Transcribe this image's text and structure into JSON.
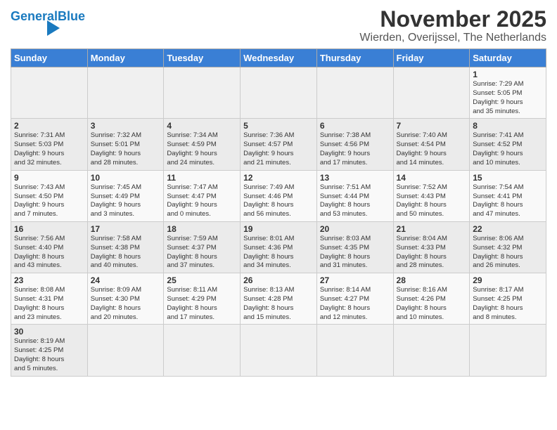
{
  "header": {
    "logo_general": "General",
    "logo_blue": "Blue",
    "title": "November 2025",
    "subtitle": "Wierden, Overijssel, The Netherlands"
  },
  "columns": [
    "Sunday",
    "Monday",
    "Tuesday",
    "Wednesday",
    "Thursday",
    "Friday",
    "Saturday"
  ],
  "weeks": [
    [
      {
        "day": "",
        "info": ""
      },
      {
        "day": "",
        "info": ""
      },
      {
        "day": "",
        "info": ""
      },
      {
        "day": "",
        "info": ""
      },
      {
        "day": "",
        "info": ""
      },
      {
        "day": "",
        "info": ""
      },
      {
        "day": "1",
        "info": "Sunrise: 7:29 AM\nSunset: 5:05 PM\nDaylight: 9 hours\nand 35 minutes."
      }
    ],
    [
      {
        "day": "2",
        "info": "Sunrise: 7:31 AM\nSunset: 5:03 PM\nDaylight: 9 hours\nand 32 minutes."
      },
      {
        "day": "3",
        "info": "Sunrise: 7:32 AM\nSunset: 5:01 PM\nDaylight: 9 hours\nand 28 minutes."
      },
      {
        "day": "4",
        "info": "Sunrise: 7:34 AM\nSunset: 4:59 PM\nDaylight: 9 hours\nand 24 minutes."
      },
      {
        "day": "5",
        "info": "Sunrise: 7:36 AM\nSunset: 4:57 PM\nDaylight: 9 hours\nand 21 minutes."
      },
      {
        "day": "6",
        "info": "Sunrise: 7:38 AM\nSunset: 4:56 PM\nDaylight: 9 hours\nand 17 minutes."
      },
      {
        "day": "7",
        "info": "Sunrise: 7:40 AM\nSunset: 4:54 PM\nDaylight: 9 hours\nand 14 minutes."
      },
      {
        "day": "8",
        "info": "Sunrise: 7:41 AM\nSunset: 4:52 PM\nDaylight: 9 hours\nand 10 minutes."
      }
    ],
    [
      {
        "day": "9",
        "info": "Sunrise: 7:43 AM\nSunset: 4:50 PM\nDaylight: 9 hours\nand 7 minutes."
      },
      {
        "day": "10",
        "info": "Sunrise: 7:45 AM\nSunset: 4:49 PM\nDaylight: 9 hours\nand 3 minutes."
      },
      {
        "day": "11",
        "info": "Sunrise: 7:47 AM\nSunset: 4:47 PM\nDaylight: 9 hours\nand 0 minutes."
      },
      {
        "day": "12",
        "info": "Sunrise: 7:49 AM\nSunset: 4:46 PM\nDaylight: 8 hours\nand 56 minutes."
      },
      {
        "day": "13",
        "info": "Sunrise: 7:51 AM\nSunset: 4:44 PM\nDaylight: 8 hours\nand 53 minutes."
      },
      {
        "day": "14",
        "info": "Sunrise: 7:52 AM\nSunset: 4:43 PM\nDaylight: 8 hours\nand 50 minutes."
      },
      {
        "day": "15",
        "info": "Sunrise: 7:54 AM\nSunset: 4:41 PM\nDaylight: 8 hours\nand 47 minutes."
      }
    ],
    [
      {
        "day": "16",
        "info": "Sunrise: 7:56 AM\nSunset: 4:40 PM\nDaylight: 8 hours\nand 43 minutes."
      },
      {
        "day": "17",
        "info": "Sunrise: 7:58 AM\nSunset: 4:38 PM\nDaylight: 8 hours\nand 40 minutes."
      },
      {
        "day": "18",
        "info": "Sunrise: 7:59 AM\nSunset: 4:37 PM\nDaylight: 8 hours\nand 37 minutes."
      },
      {
        "day": "19",
        "info": "Sunrise: 8:01 AM\nSunset: 4:36 PM\nDaylight: 8 hours\nand 34 minutes."
      },
      {
        "day": "20",
        "info": "Sunrise: 8:03 AM\nSunset: 4:35 PM\nDaylight: 8 hours\nand 31 minutes."
      },
      {
        "day": "21",
        "info": "Sunrise: 8:04 AM\nSunset: 4:33 PM\nDaylight: 8 hours\nand 28 minutes."
      },
      {
        "day": "22",
        "info": "Sunrise: 8:06 AM\nSunset: 4:32 PM\nDaylight: 8 hours\nand 26 minutes."
      }
    ],
    [
      {
        "day": "23",
        "info": "Sunrise: 8:08 AM\nSunset: 4:31 PM\nDaylight: 8 hours\nand 23 minutes."
      },
      {
        "day": "24",
        "info": "Sunrise: 8:09 AM\nSunset: 4:30 PM\nDaylight: 8 hours\nand 20 minutes."
      },
      {
        "day": "25",
        "info": "Sunrise: 8:11 AM\nSunset: 4:29 PM\nDaylight: 8 hours\nand 17 minutes."
      },
      {
        "day": "26",
        "info": "Sunrise: 8:13 AM\nSunset: 4:28 PM\nDaylight: 8 hours\nand 15 minutes."
      },
      {
        "day": "27",
        "info": "Sunrise: 8:14 AM\nSunset: 4:27 PM\nDaylight: 8 hours\nand 12 minutes."
      },
      {
        "day": "28",
        "info": "Sunrise: 8:16 AM\nSunset: 4:26 PM\nDaylight: 8 hours\nand 10 minutes."
      },
      {
        "day": "29",
        "info": "Sunrise: 8:17 AM\nSunset: 4:25 PM\nDaylight: 8 hours\nand 8 minutes."
      }
    ],
    [
      {
        "day": "30",
        "info": "Sunrise: 8:19 AM\nSunset: 4:25 PM\nDaylight: 8 hours\nand 5 minutes."
      },
      {
        "day": "",
        "info": ""
      },
      {
        "day": "",
        "info": ""
      },
      {
        "day": "",
        "info": ""
      },
      {
        "day": "",
        "info": ""
      },
      {
        "day": "",
        "info": ""
      },
      {
        "day": "",
        "info": ""
      }
    ]
  ]
}
